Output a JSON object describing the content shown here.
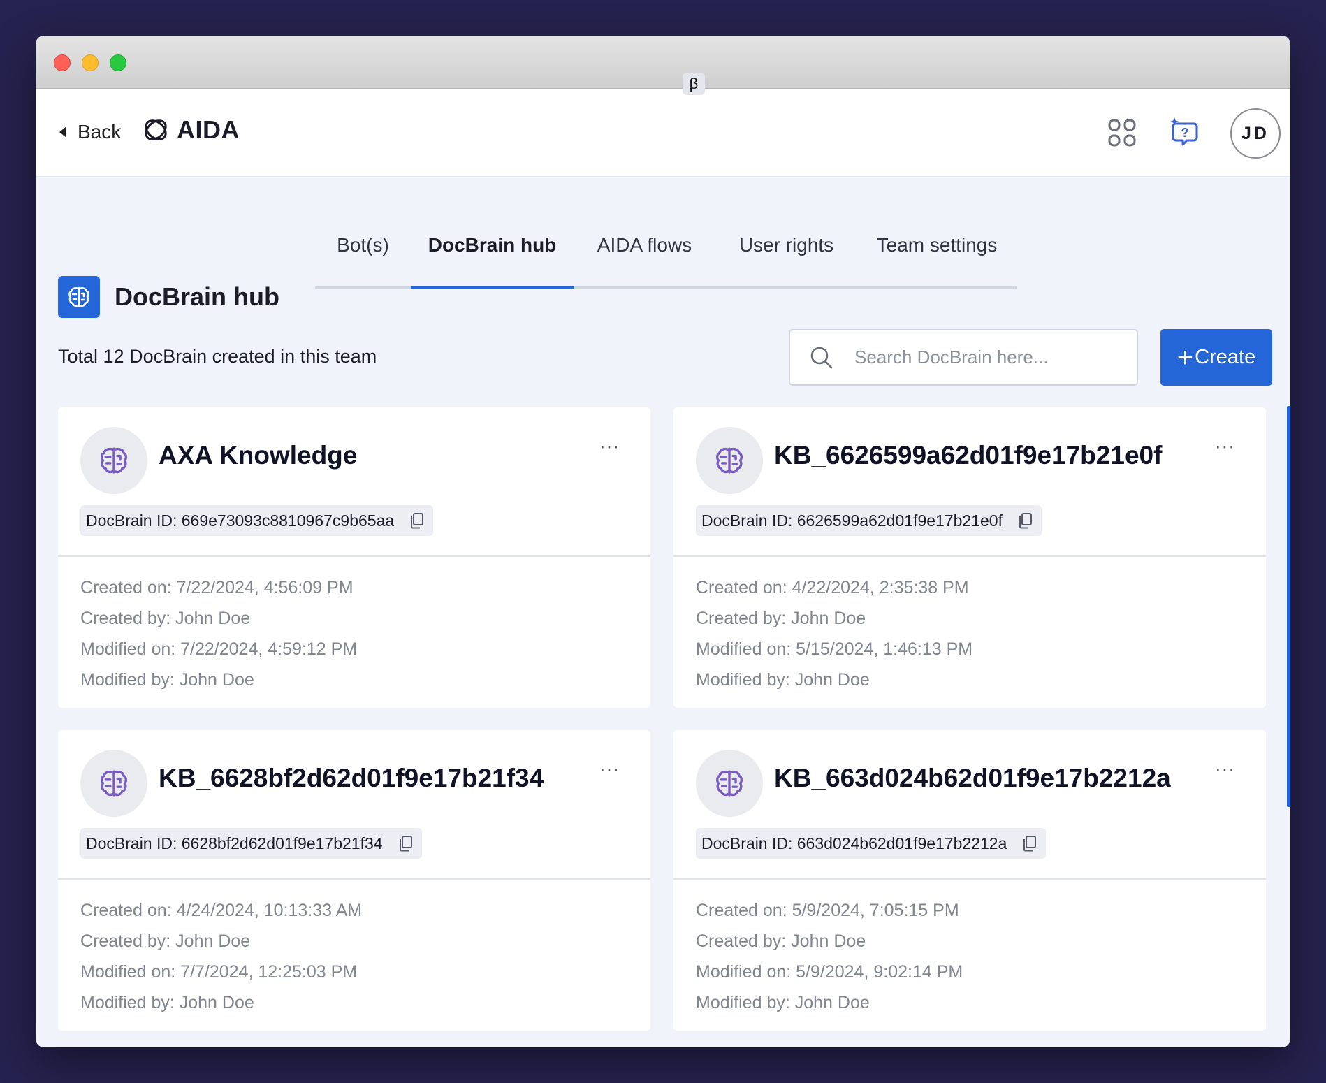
{
  "nav": {
    "back_label": "Back",
    "brand_name": "AIDA",
    "avatar_initials": "JD"
  },
  "tabs": [
    {
      "label": "Bot(s)"
    },
    {
      "label": "DocBrain hub"
    },
    {
      "label": "AIDA flows",
      "badge": "β"
    },
    {
      "label": "User rights"
    },
    {
      "label": "Team settings"
    }
  ],
  "page": {
    "title": "DocBrain hub",
    "total_text": "Total 12 DocBrain created in this team",
    "search_placeholder": "Search DocBrain here...",
    "create_label": "Create",
    "create_icon": "+"
  },
  "cards": [
    {
      "title": "AXA Knowledge",
      "id_text": "DocBrain ID: 669e73093c8810967c9b65aa",
      "created_on": "Created on: 7/22/2024, 4:56:09 PM",
      "created_by": "Created by: John Doe",
      "modified_on": "Modified on: 7/22/2024, 4:59:12 PM",
      "modified_by": "Modified by: John Doe",
      "menu": "···"
    },
    {
      "title": "KB_6626599a62d01f9e17b21e0f",
      "id_text": "DocBrain ID: 6626599a62d01f9e17b21e0f",
      "created_on": "Created on: 4/22/2024, 2:35:38 PM",
      "created_by": "Created by: John Doe",
      "modified_on": "Modified on: 5/15/2024, 1:46:13 PM",
      "modified_by": "Modified by: John Doe",
      "menu": "···"
    },
    {
      "title": "KB_6628bf2d62d01f9e17b21f34",
      "id_text": "DocBrain ID: 6628bf2d62d01f9e17b21f34",
      "created_on": "Created on: 4/24/2024, 10:13:33 AM",
      "created_by": "Created by: John Doe",
      "modified_on": "Modified on: 7/7/2024, 12:25:03 PM",
      "modified_by": "Modified by: John Doe",
      "menu": "···"
    },
    {
      "title": "KB_663d024b62d01f9e17b2212a",
      "id_text": "DocBrain ID: 663d024b62d01f9e17b2212a",
      "created_on": "Created on: 5/9/2024, 7:05:15 PM",
      "created_by": "Created by: John Doe",
      "modified_on": "Modified on: 5/9/2024, 9:02:14 PM",
      "modified_by": "Modified by: John Doe",
      "menu": "···"
    }
  ],
  "icons": {
    "back": "caret-left-icon",
    "brand": "aida-logo-icon",
    "apps": "apps-grid-icon",
    "help": "help-sparkle-icon",
    "section": "docbrain-icon",
    "search": "search-icon",
    "card": "docbrain-icon",
    "copy": "copy-icon",
    "menu": "more-horizontal-icon"
  },
  "colors": {
    "accent": "#2465d8",
    "card_icon": "#7a5bc4",
    "help_icon": "#3e5fd0",
    "background": "#f0f3fa",
    "outer_background": "#26224f"
  }
}
